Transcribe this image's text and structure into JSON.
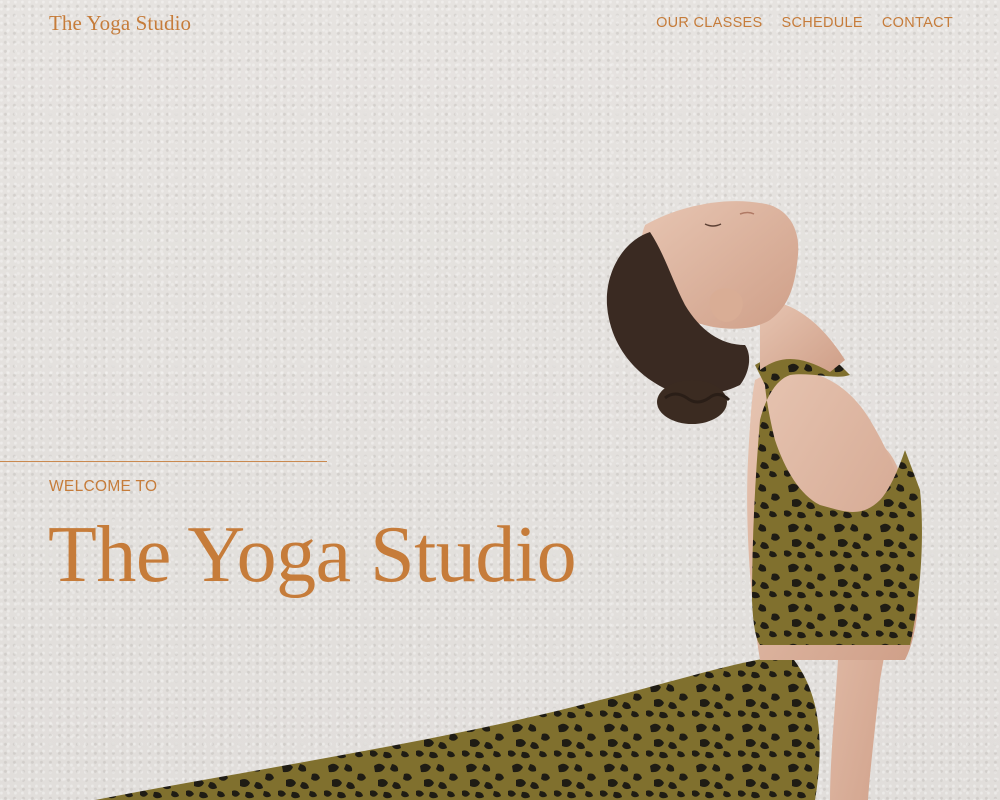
{
  "header": {
    "logo": "The Yoga Studio",
    "nav": [
      {
        "label": "OUR CLASSES"
      },
      {
        "label": "SCHEDULE"
      },
      {
        "label": "CONTACT"
      }
    ]
  },
  "hero": {
    "eyebrow": "WELCOME TO",
    "title": "The Yoga Studio"
  },
  "colors": {
    "accent": "#c67c3a",
    "background": "#e3e0dd",
    "outfit": "#7d6a2a"
  }
}
